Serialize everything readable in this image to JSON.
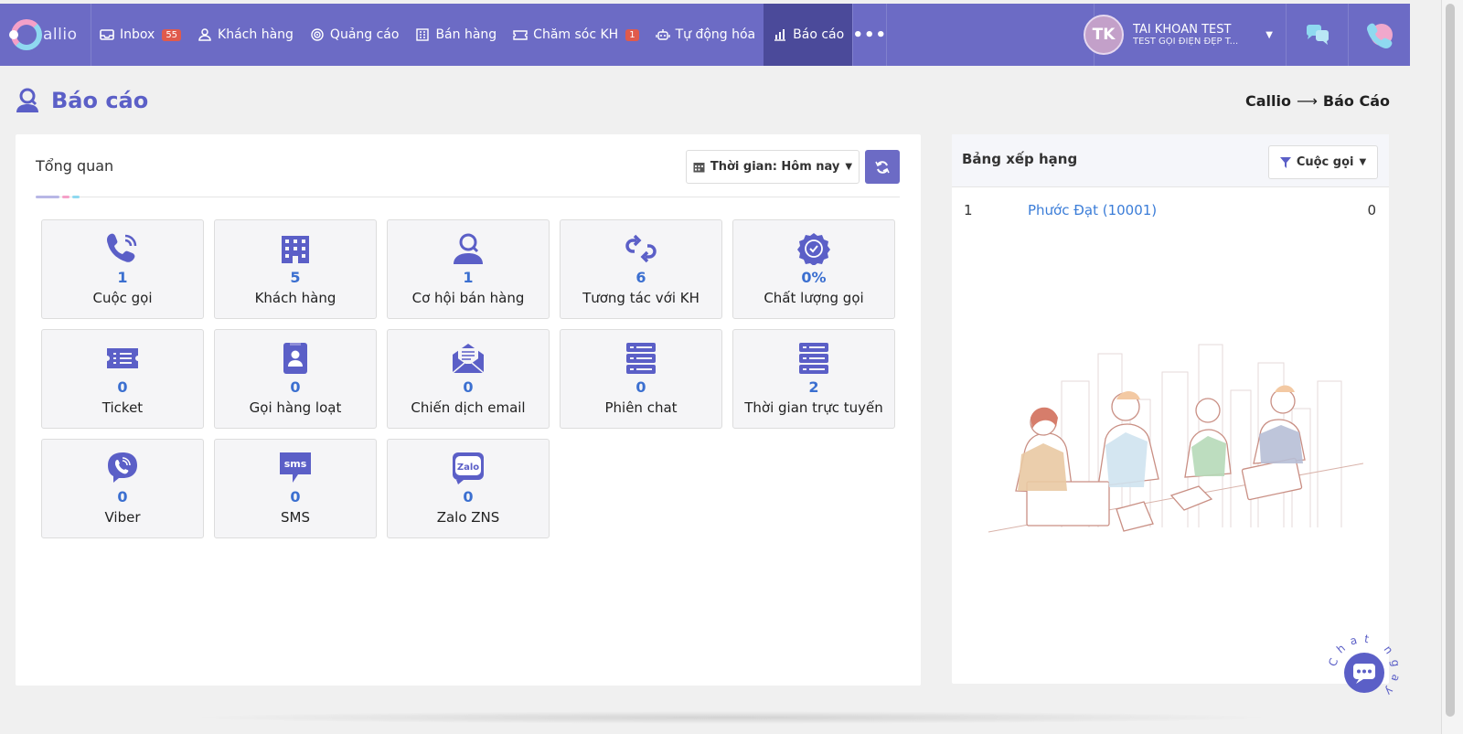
{
  "app": {
    "logo_text": "allio"
  },
  "nav": [
    {
      "label": "Inbox",
      "icon": "inbox-icon",
      "badge": "55"
    },
    {
      "label": "Khách hàng",
      "icon": "customer-icon",
      "badge": ""
    },
    {
      "label": "Quảng cáo",
      "icon": "target-icon",
      "badge": ""
    },
    {
      "label": "Bán hàng",
      "icon": "building-icon",
      "badge": ""
    },
    {
      "label": "Chăm sóc KH",
      "icon": "ticket-icon",
      "badge": "1"
    },
    {
      "label": "Tự động hóa",
      "icon": "robot-icon",
      "badge": ""
    },
    {
      "label": "Báo cáo",
      "icon": "report-chart-icon",
      "badge": "",
      "active": true
    }
  ],
  "nav_more": "•••",
  "account": {
    "initials": "TK",
    "name": "TÀI KHOẢN TEST",
    "subtitle": "TEST GỌI ĐIỆN ĐẸP T..."
  },
  "page": {
    "title": "Báo cáo",
    "breadcrumb_root": "Callio",
    "breadcrumb_arrow": "⟶",
    "breadcrumb_current": "Báo Cáo"
  },
  "overview": {
    "title": "Tổng quan",
    "time_filter": "Thời gian: Hôm nay",
    "cards": [
      {
        "value": "1",
        "label": "Cuộc gọi",
        "icon": "phone-call-icon"
      },
      {
        "value": "5",
        "label": "Khách hàng",
        "icon": "building-icon"
      },
      {
        "value": "1",
        "label": "Cơ hội bán hàng",
        "icon": "user-search-icon"
      },
      {
        "value": "6",
        "label": "Tương tác với KH",
        "icon": "interaction-arrows-icon"
      },
      {
        "value": "0%",
        "label": "Chất lượng gọi",
        "icon": "quality-badge-icon"
      },
      {
        "value": "0",
        "label": "Ticket",
        "icon": "ticket-icon"
      },
      {
        "value": "0",
        "label": "Gọi hàng loạt",
        "icon": "contact-book-icon"
      },
      {
        "value": "0",
        "label": "Chiến dịch email",
        "icon": "email-campaign-icon"
      },
      {
        "value": "0",
        "label": "Phiên chat",
        "icon": "server-list-icon"
      },
      {
        "value": "2",
        "label": "Thời gian trực tuyến",
        "icon": "server-list-icon"
      },
      {
        "value": "0",
        "label": "Viber",
        "icon": "viber-icon"
      },
      {
        "value": "0",
        "label": "SMS",
        "icon": "sms-icon"
      },
      {
        "value": "0",
        "label": "Zalo ZNS",
        "icon": "zalo-icon"
      }
    ]
  },
  "ranking": {
    "title": "Bảng xếp hạng",
    "filter": "Cuộc gọi",
    "rows": [
      {
        "rank": "1",
        "name": "Phước Đạt (10001)",
        "score": "0"
      }
    ]
  },
  "chat_widget": {
    "label": "Chat ngay"
  },
  "colors": {
    "primary": "#6c6bc5",
    "active_nav": "#4b4a9a",
    "value_blue": "#3b6fd0",
    "link_blue": "#3b7dd8",
    "badge_red": "#e05a4c"
  }
}
